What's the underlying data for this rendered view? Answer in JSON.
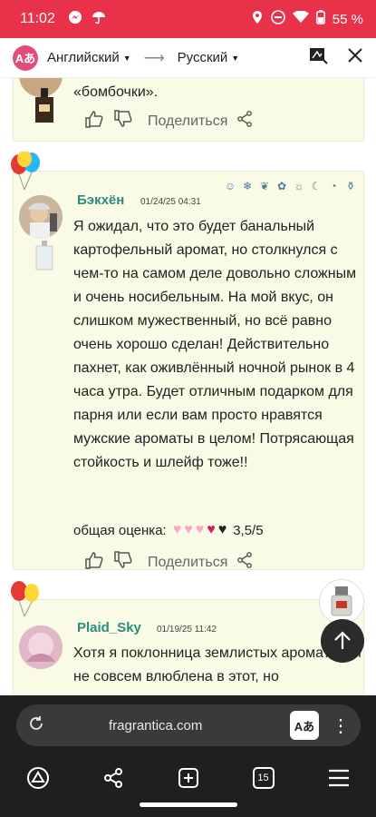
{
  "status": {
    "time": "11:02",
    "battery": "55 %"
  },
  "translate": {
    "source_lang": "Английский",
    "target_lang": "Русский"
  },
  "reviews": [
    {
      "text": "его проявлении, но не благовония и не «бомбочки».",
      "share_label": "Поделиться"
    },
    {
      "username": "Бэкхён",
      "date": "01/24/25 04:31",
      "text": "Я ожидал, что это будет банальный картофельный аромат, но столкнулся с чем-то на самом деле довольно сложным и очень носибельным. На мой вкус, он слишком мужественный, но всё равно очень хорошо сделан! Действительно пахнет, как оживлённый ночной рынок в 4 часа утра. Будет отличным подарком для парня или если вам просто нравятся мужские ароматы в целом! Потрясающая стойкость и шлейф тоже!!",
      "rating_label": "общая оценка:",
      "rating_value": "3,5/5",
      "share_label": "Поделиться"
    },
    {
      "username": "Plaid_Sky",
      "date": "01/19/25 11:42",
      "text": "Хотя я поклонница землистых ароматов, я не совсем влюблена в этот, но"
    }
  ],
  "browser": {
    "url": "fragrantica.com",
    "tab_count": "15"
  },
  "colors": {
    "status_bar": "#e8324a",
    "username": "#2a8c7a",
    "card_bg": "#f9fbe7"
  }
}
